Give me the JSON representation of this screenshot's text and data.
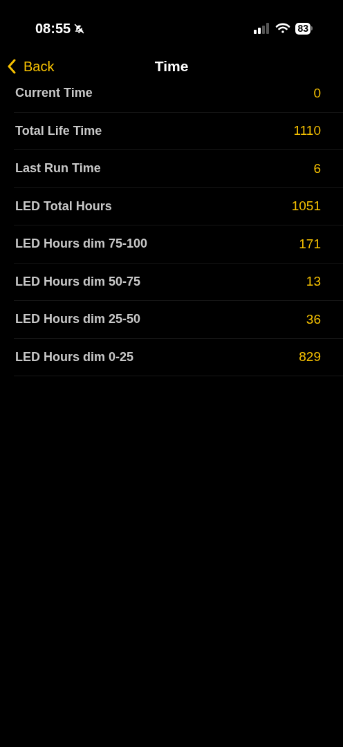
{
  "status_bar": {
    "time": "08:55",
    "battery": "83"
  },
  "nav": {
    "back": "Back",
    "title": "Time"
  },
  "rows": [
    {
      "label": "Current Time",
      "value": "0"
    },
    {
      "label": "Total Life Time",
      "value": "1110"
    },
    {
      "label": "Last Run Time",
      "value": "6"
    },
    {
      "label": "LED Total Hours",
      "value": "1051"
    },
    {
      "label": "LED Hours dim 75-100",
      "value": "171"
    },
    {
      "label": "LED Hours dim 50-75",
      "value": "13"
    },
    {
      "label": "LED Hours dim 25-50",
      "value": "36"
    },
    {
      "label": "LED Hours dim 0-25",
      "value": "829"
    }
  ]
}
